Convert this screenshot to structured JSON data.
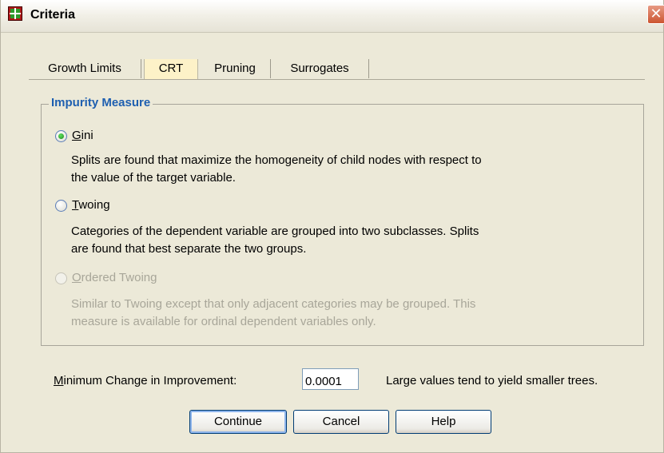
{
  "window": {
    "title": "Criteria",
    "close_glyph": "✕"
  },
  "tabs": [
    {
      "label": "Growth Limits"
    },
    {
      "label": "CRT",
      "selected": true
    },
    {
      "label": "Pruning"
    },
    {
      "label": "Surrogates"
    }
  ],
  "impurity": {
    "legend": "Impurity Measure",
    "options": [
      {
        "mnemonic": "G",
        "rest": "ini",
        "checked": true,
        "enabled": true,
        "description": [
          "Splits are found that maximize the homogeneity of child nodes with respect to",
          "the value of the target variable."
        ]
      },
      {
        "mnemonic": "T",
        "rest": "woing",
        "checked": false,
        "enabled": true,
        "description": [
          "Categories of the dependent variable are grouped into two subclasses. Splits",
          "are found that best separate the two groups."
        ]
      },
      {
        "mnemonic": "O",
        "rest": "rdered Twoing",
        "checked": false,
        "enabled": false,
        "description": [
          "Similar to Twoing except that only adjacent categories may be grouped. This",
          "measure is available for ordinal dependent variables only."
        ]
      }
    ]
  },
  "min_change": {
    "mnemonic": "M",
    "rest": "inimum Change in Improvement:",
    "value": "0.0001",
    "hint": "Large values tend to yield smaller trees."
  },
  "buttons": {
    "continue": "Continue",
    "cancel": "Cancel",
    "help": "Help"
  },
  "colors": {
    "legend": "#1e5fb0",
    "selected_tab": "#fdf2c8",
    "dialog_bg": "#ece9d8",
    "disabled": "#a8a699"
  },
  "icons": {
    "app": "spss-app-icon",
    "close": "close-icon"
  }
}
